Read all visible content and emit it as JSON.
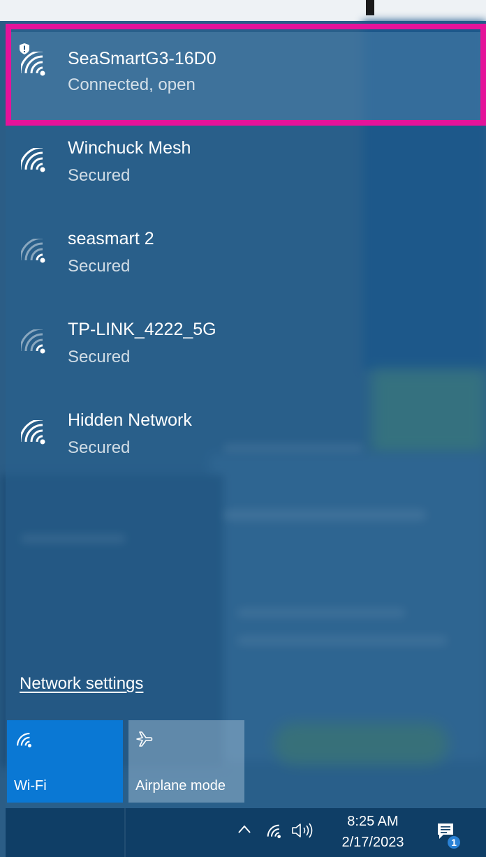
{
  "networks": [
    {
      "name": "SeaSmartG3-16D0",
      "status": "Connected, open",
      "icon": "wifi-open-shield-icon",
      "selected": true
    },
    {
      "name": "Winchuck Mesh",
      "status": "Secured",
      "icon": "wifi-full-icon"
    },
    {
      "name": "seasmart 2",
      "status": "Secured",
      "icon": "wifi-weak-icon"
    },
    {
      "name": "TP-LINK_4222_5G",
      "status": "Secured",
      "icon": "wifi-weak-icon"
    },
    {
      "name": "Hidden Network",
      "status": "Secured",
      "icon": "wifi-full-icon"
    }
  ],
  "network_settings_label": "Network settings",
  "quick_actions": [
    {
      "label": "Wi-Fi",
      "icon": "wifi-icon",
      "active": true
    },
    {
      "label": "Airplane mode",
      "icon": "airplane-icon",
      "active": false
    }
  ],
  "taskbar": {
    "time": "8:25 AM",
    "date": "2/17/2023",
    "notification_count": "1"
  },
  "colors": {
    "highlight": "#e5139a",
    "wifi_tile": "#0a78d4",
    "taskbar": "#0f3e66"
  }
}
